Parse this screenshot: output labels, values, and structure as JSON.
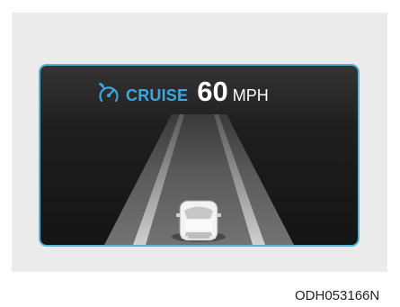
{
  "display": {
    "icon": "cruise-gauge-icon",
    "mode_label": "CRUISE",
    "speed_value": "60",
    "speed_unit": "MPH",
    "accent_color": "#3aa8de",
    "border_color": "#56b4da"
  },
  "figure": {
    "code": "ODH053166N"
  }
}
